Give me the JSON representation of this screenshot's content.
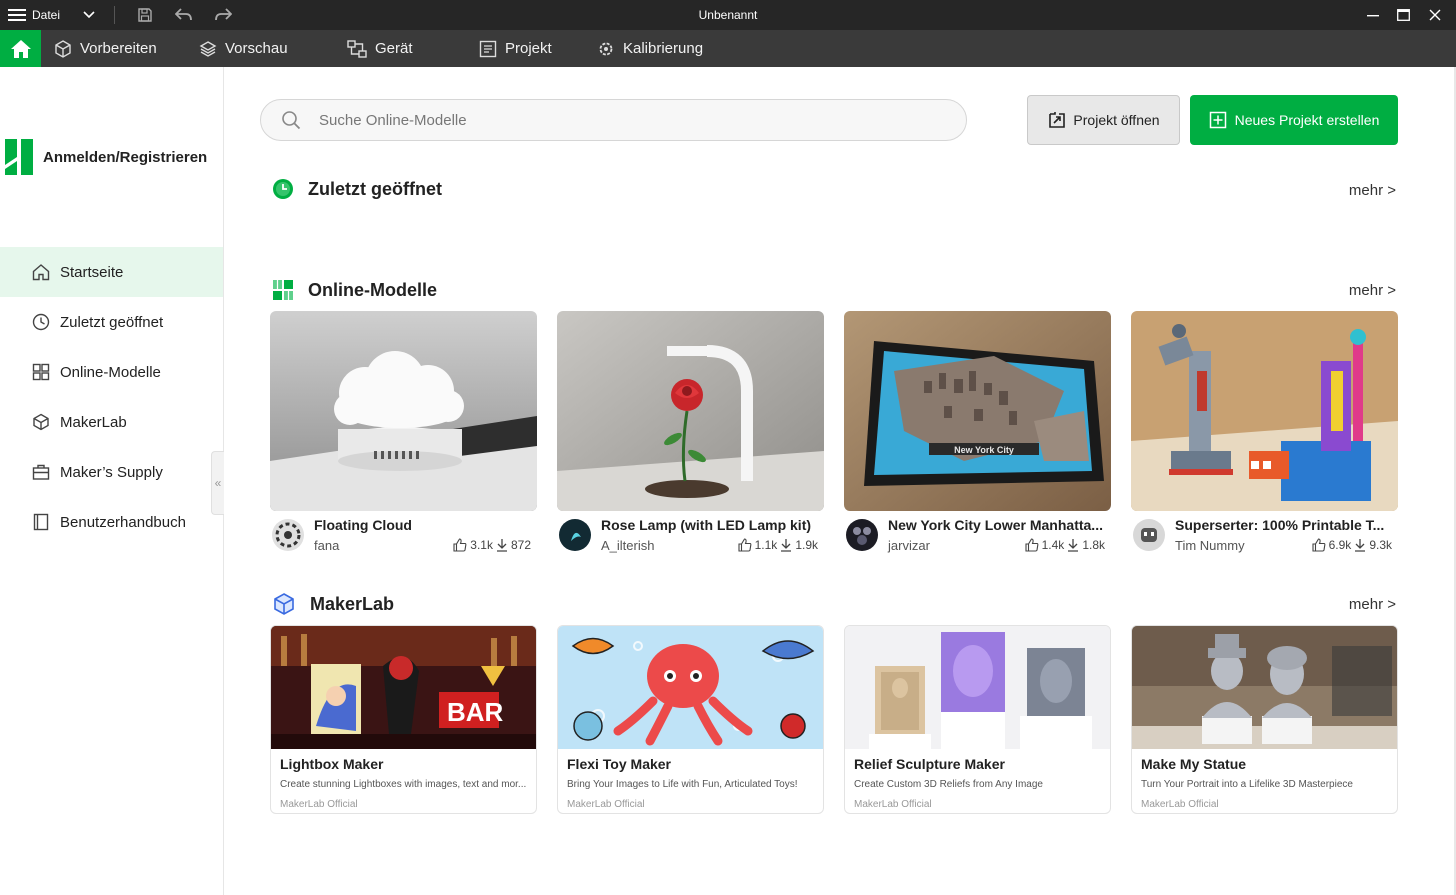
{
  "titlebar": {
    "file_label": "Datei",
    "window_title": "Unbenannt"
  },
  "nav": {
    "tabs": [
      "Vorbereiten",
      "Vorschau",
      "Gerät",
      "Projekt",
      "Kalibrierung"
    ]
  },
  "sidebar": {
    "login_label": "Anmelden/Registrieren",
    "items": [
      "Startseite",
      "Zuletzt geöffnet",
      "Online-Modelle",
      "MakerLab",
      "Maker’s Supply",
      "Benutzerhandbuch"
    ],
    "active_index": 0
  },
  "search": {
    "placeholder": "Suche Online-Modelle",
    "value": ""
  },
  "buttons": {
    "open_project": "Projekt öffnen",
    "new_project": "Neues Projekt erstellen"
  },
  "sections": {
    "recent": "Zuletzt geöffnet",
    "online": "Online-Modelle",
    "makerlab": "MakerLab",
    "more": "mehr >"
  },
  "colors": {
    "accent": "#00ae42",
    "titlebar": "#262626",
    "navbar": "#3a3a3a",
    "active_bg": "#e6f7ec"
  },
  "online_models": [
    {
      "title": "Floating Cloud",
      "author": "fana",
      "likes": "3.1k",
      "downloads": "872"
    },
    {
      "title": "Rose Lamp (with LED Lamp kit)",
      "author": "A_ilterish",
      "likes": "1.1k",
      "downloads": "1.9k"
    },
    {
      "title": "New York City Lower Manhatta...",
      "author": "jarvizar",
      "likes": "1.4k",
      "downloads": "1.8k",
      "label": "New York City"
    },
    {
      "title": "Superserter: 100% Printable T...",
      "author": "Tim Nummy",
      "likes": "6.9k",
      "downloads": "9.3k"
    }
  ],
  "makerlab": [
    {
      "title": "Lightbox Maker",
      "desc": "Create stunning Lightboxes with images, text and mor...",
      "author": "MakerLab Official",
      "sign": "BAR"
    },
    {
      "title": "Flexi Toy Maker",
      "desc": "Bring Your Images to Life with Fun, Articulated Toys!",
      "author": "MakerLab Official"
    },
    {
      "title": "Relief Sculpture Maker",
      "desc": "Create Custom 3D Reliefs from Any Image",
      "author": "MakerLab Official"
    },
    {
      "title": "Make My Statue",
      "desc": "Turn Your Portrait into a Lifelike 3D Masterpiece",
      "author": "MakerLab Official"
    }
  ]
}
